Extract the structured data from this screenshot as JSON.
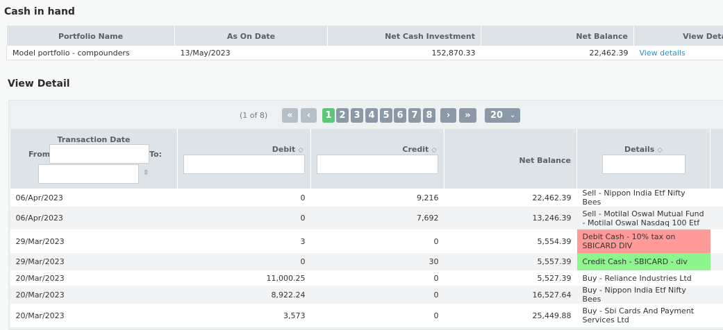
{
  "cash_title": "Cash in hand",
  "summary": {
    "headers": [
      "Portfolio Name",
      "As On Date",
      "Net Cash Investment",
      "Net Balance",
      "View Deta"
    ],
    "row": {
      "portfolio": "Model portfolio - compounders",
      "date": "13/May/2023",
      "investment": "152,870.33",
      "balance": "22,462.39",
      "link": "View details"
    }
  },
  "detail_title": "View Detail",
  "pager": {
    "info": "(1 of 8)",
    "first": "«",
    "prev": "‹",
    "pages": [
      "1",
      "2",
      "3",
      "4",
      "5",
      "6",
      "7",
      "8"
    ],
    "next": "›",
    "last": "»",
    "page_size": "20"
  },
  "detail": {
    "headers": {
      "date": "Transaction Date",
      "from": "From:",
      "to": "To:",
      "debit": "Debit",
      "credit": "Credit",
      "net": "Net Balance",
      "details": "Details"
    },
    "rows": [
      {
        "date": "06/Apr/2023",
        "debit": "0",
        "credit": "9,216",
        "net": "22,462.39",
        "details": "Sell - Nippon India Etf Nifty Bees"
      },
      {
        "date": "06/Apr/2023",
        "debit": "0",
        "credit": "7,692",
        "net": "13,246.39",
        "details": "Sell - Motilal Oswal Mutual Fund - Motilal Oswal Nasdaq 100 Etf"
      },
      {
        "date": "29/Mar/2023",
        "debit": "3",
        "credit": "0",
        "net": "5,554.39",
        "details": "Debit Cash - 10% tax on SBICARD DIV"
      },
      {
        "date": "29/Mar/2023",
        "debit": "0",
        "credit": "30",
        "net": "5,557.39",
        "details": "Credit Cash - SBICARD - div"
      },
      {
        "date": "20/Mar/2023",
        "debit": "11,000.25",
        "credit": "0",
        "net": "5,527.39",
        "details": "Buy - Reliance Industries Ltd"
      },
      {
        "date": "20/Mar/2023",
        "debit": "8,922.24",
        "credit": "0",
        "net": "16,527.64",
        "details": "Buy - Nippon India Etf Nifty Bees"
      },
      {
        "date": "20/Mar/2023",
        "debit": "3,573",
        "credit": "0",
        "net": "25,449.88",
        "details": "Buy - Sbi Cards And Payment Services Ltd"
      }
    ]
  },
  "colors": {
    "debit_highlight": "#ff9a9a",
    "credit_highlight": "#8ef58e",
    "active_page": "#5bc77a"
  }
}
